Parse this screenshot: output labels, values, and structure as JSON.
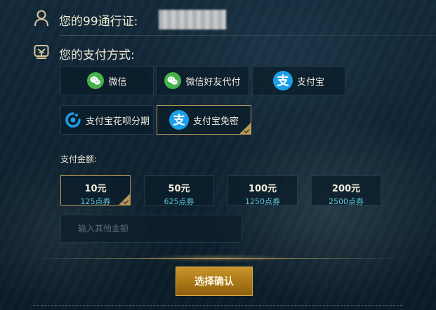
{
  "account": {
    "label": "您的99通行证:"
  },
  "payment": {
    "label": "您的支付方式:",
    "methods": [
      {
        "label": "微信",
        "icon": "wechat-icon"
      },
      {
        "label": "微信好友代付",
        "icon": "wechat-icon"
      },
      {
        "label": "支付宝",
        "icon": "alipay-icon"
      },
      {
        "label": "支付宝花呗分期",
        "icon": "huabei-icon"
      },
      {
        "label": "支付宝免密",
        "icon": "alipay-icon",
        "selected": true
      }
    ]
  },
  "amount": {
    "label": "支付金额:",
    "options": [
      {
        "value": "10元",
        "points": "125点券",
        "selected": true
      },
      {
        "value": "50元",
        "points": "625点券"
      },
      {
        "value": "100元",
        "points": "1250点券"
      },
      {
        "value": "200元",
        "points": "2500点券"
      }
    ],
    "other_placeholder": "输入其他金额"
  },
  "confirm_label": "选择确认",
  "colors": {
    "gold": "#b59658",
    "points_text": "#5fc6d6",
    "wechat": "#47b14b",
    "alipay": "#1a9fe8"
  }
}
